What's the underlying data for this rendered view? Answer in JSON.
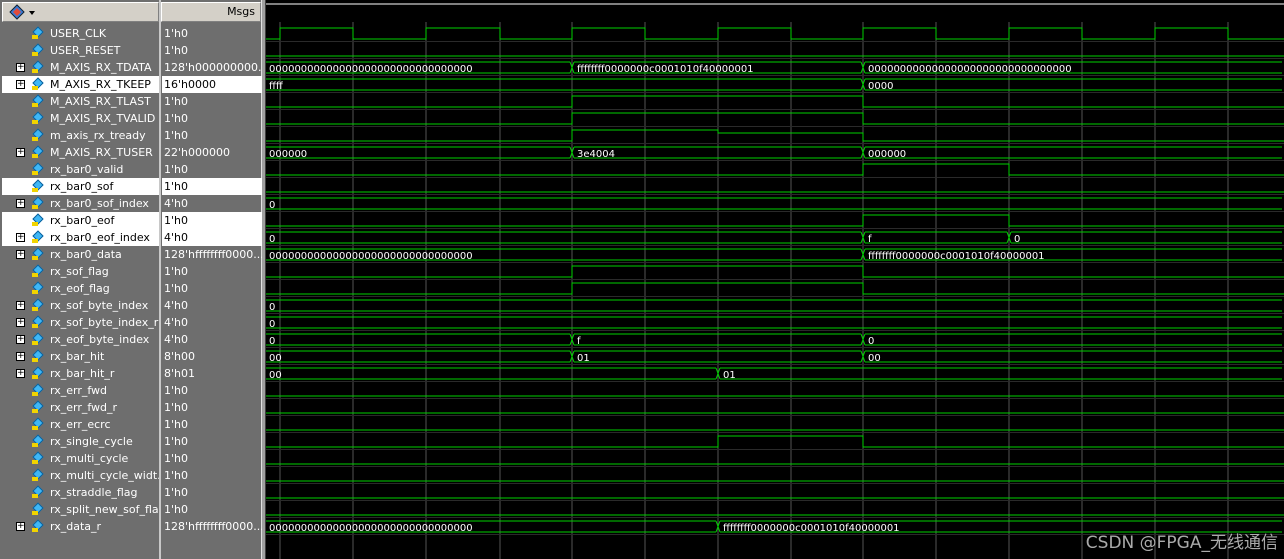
{
  "header": {
    "msgs_label": "Msgs",
    "logo_icon": "wave-logo-icon"
  },
  "signals": [
    {
      "name": "USER_CLK",
      "value": "1'h0",
      "expand": false,
      "type": "clock"
    },
    {
      "name": "USER_RESET",
      "value": "1'h0",
      "expand": false,
      "type": "flat_low"
    },
    {
      "name": "M_AXIS_RX_TDATA",
      "value": "128'h000000000...",
      "expand": true,
      "type": "bus",
      "segs": [
        "00000000000000000000000000000000",
        "ffffffff0000000c0001010f40000001",
        "00000000000000000000000000000000"
      ]
    },
    {
      "name": "M_AXIS_RX_TKEEP",
      "value": "16'h0000",
      "expand": true,
      "type": "bus",
      "selected": true,
      "segs": [
        "ffff",
        "0000"
      ]
    },
    {
      "name": "M_AXIS_RX_TLAST",
      "value": "1'h0",
      "expand": false,
      "type": "pulse"
    },
    {
      "name": "M_AXIS_RX_TVALID",
      "value": "1'h0",
      "expand": false,
      "type": "pulse"
    },
    {
      "name": "m_axis_rx_tready",
      "value": "1'h0",
      "expand": false,
      "type": "tready"
    },
    {
      "name": "M_AXIS_RX_TUSER",
      "value": "22'h000000",
      "expand": true,
      "type": "bus",
      "segs": [
        "000000",
        "3e4004",
        "000000"
      ]
    },
    {
      "name": "rx_bar0_valid",
      "value": "1'h0",
      "expand": false,
      "type": "pulse2"
    },
    {
      "name": "rx_bar0_sof",
      "value": "1'h0",
      "expand": false,
      "type": "flat_low",
      "selected": true
    },
    {
      "name": "rx_bar0_sof_index",
      "value": "4'h0",
      "expand": true,
      "type": "bus",
      "segs": [
        "0"
      ]
    },
    {
      "name": "rx_bar0_eof",
      "value": "1'h0",
      "expand": false,
      "type": "pulse2",
      "selected": true
    },
    {
      "name": "rx_bar0_eof_index",
      "value": "4'h0",
      "expand": true,
      "type": "bus",
      "selected": true,
      "segs": [
        "0",
        "f",
        "0"
      ]
    },
    {
      "name": "rx_bar0_data",
      "value": "128'hffffffff0000...",
      "expand": true,
      "type": "bus",
      "segs": [
        "00000000000000000000000000000000",
        "ffffffff0000000c0001010f40000001"
      ]
    },
    {
      "name": "rx_sof_flag",
      "value": "1'h0",
      "expand": false,
      "type": "pulse"
    },
    {
      "name": "rx_eof_flag",
      "value": "1'h0",
      "expand": false,
      "type": "pulse"
    },
    {
      "name": "rx_sof_byte_index",
      "value": "4'h0",
      "expand": true,
      "type": "bus",
      "segs": [
        "0"
      ]
    },
    {
      "name": "rx_sof_byte_index_r",
      "value": "4'h0",
      "expand": true,
      "type": "bus",
      "segs": [
        "0"
      ]
    },
    {
      "name": "rx_eof_byte_index",
      "value": "4'h0",
      "expand": true,
      "type": "bus",
      "segs": [
        "0",
        "f",
        "0"
      ]
    },
    {
      "name": "rx_bar_hit",
      "value": "8'h00",
      "expand": true,
      "type": "bus",
      "segs": [
        "00",
        "01",
        "00"
      ]
    },
    {
      "name": "rx_bar_hit_r",
      "value": "8'h01",
      "expand": true,
      "type": "bus",
      "segs": [
        "00",
        "01"
      ]
    },
    {
      "name": "rx_err_fwd",
      "value": "1'h0",
      "expand": false,
      "type": "flat_low"
    },
    {
      "name": "rx_err_fwd_r",
      "value": "1'h0",
      "expand": false,
      "type": "flat_low"
    },
    {
      "name": "rx_err_ecrc",
      "value": "1'h0",
      "expand": false,
      "type": "flat_low"
    },
    {
      "name": "rx_single_cycle",
      "value": "1'h0",
      "expand": false,
      "type": "pulse3"
    },
    {
      "name": "rx_multi_cycle",
      "value": "1'h0",
      "expand": false,
      "type": "flat_low"
    },
    {
      "name": "rx_multi_cycle_widt...",
      "value": "1'h0",
      "expand": false,
      "type": "flat_low"
    },
    {
      "name": "rx_straddle_flag",
      "value": "1'h0",
      "expand": false,
      "type": "flat_low"
    },
    {
      "name": "rx_split_new_sof_flag",
      "value": "1'h0",
      "expand": false,
      "type": "flat_low"
    },
    {
      "name": "rx_data_r",
      "value": "128'hffffffff0000...",
      "expand": true,
      "type": "bus",
      "segs": [
        "00000000000000000000000000000000",
        "ffffffff0000000c0001010f40000001"
      ]
    }
  ],
  "watermark": "CSDN @FPGA_无线通信",
  "colors": {
    "wave": "#00d000",
    "bg": "#000000",
    "grid": "#555555",
    "text": "#ffffff"
  }
}
